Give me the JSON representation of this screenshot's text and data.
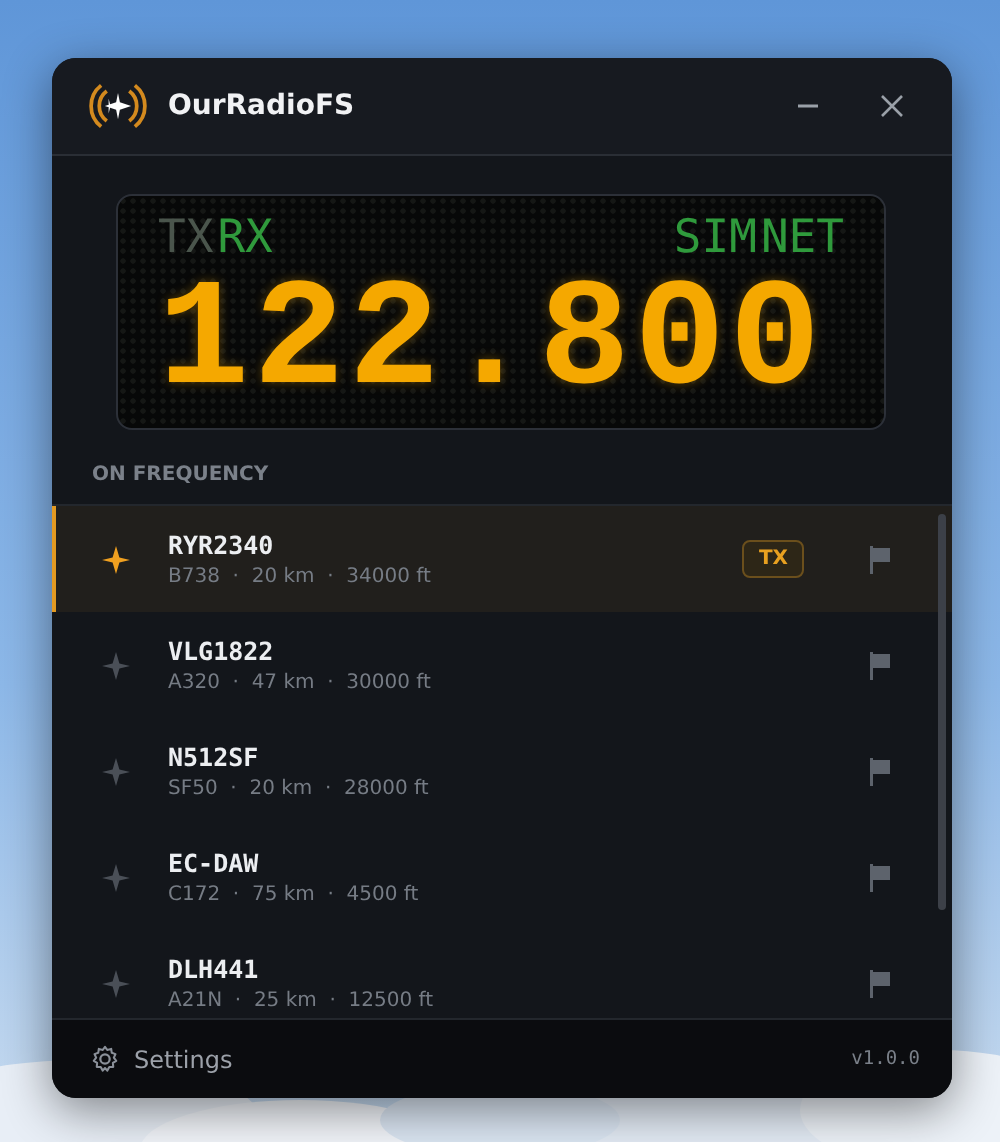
{
  "window": {
    "title": "OurRadioFS"
  },
  "display": {
    "frequency": "122.800",
    "indicators_left": [
      {
        "label": "TX",
        "on": false
      },
      {
        "label": "RX",
        "on": true
      }
    ],
    "indicators_right": [
      {
        "label": "SIM",
        "on": true
      },
      {
        "label": "NET",
        "on": true
      }
    ]
  },
  "section_title": "ON FREQUENCY",
  "stations": [
    {
      "callsign": "RYR2340",
      "details": "B738  ·  20 km  ·  34000 ft",
      "selected": true,
      "badge": "TX"
    },
    {
      "callsign": "VLG1822",
      "details": "A320  ·  47 km  ·  30000 ft",
      "selected": false
    },
    {
      "callsign": "N512SF",
      "details": "SF50  ·  20 km  ·  28000 ft",
      "selected": false
    },
    {
      "callsign": "EC-DAW",
      "details": "C172  ·  75 km  ·  4500 ft",
      "selected": false
    },
    {
      "callsign": "DLH441",
      "details": "A21N  ·  25 km  ·  12500 ft",
      "selected": false
    }
  ],
  "footer": {
    "settings": "Settings",
    "version": "v1.0.0"
  }
}
